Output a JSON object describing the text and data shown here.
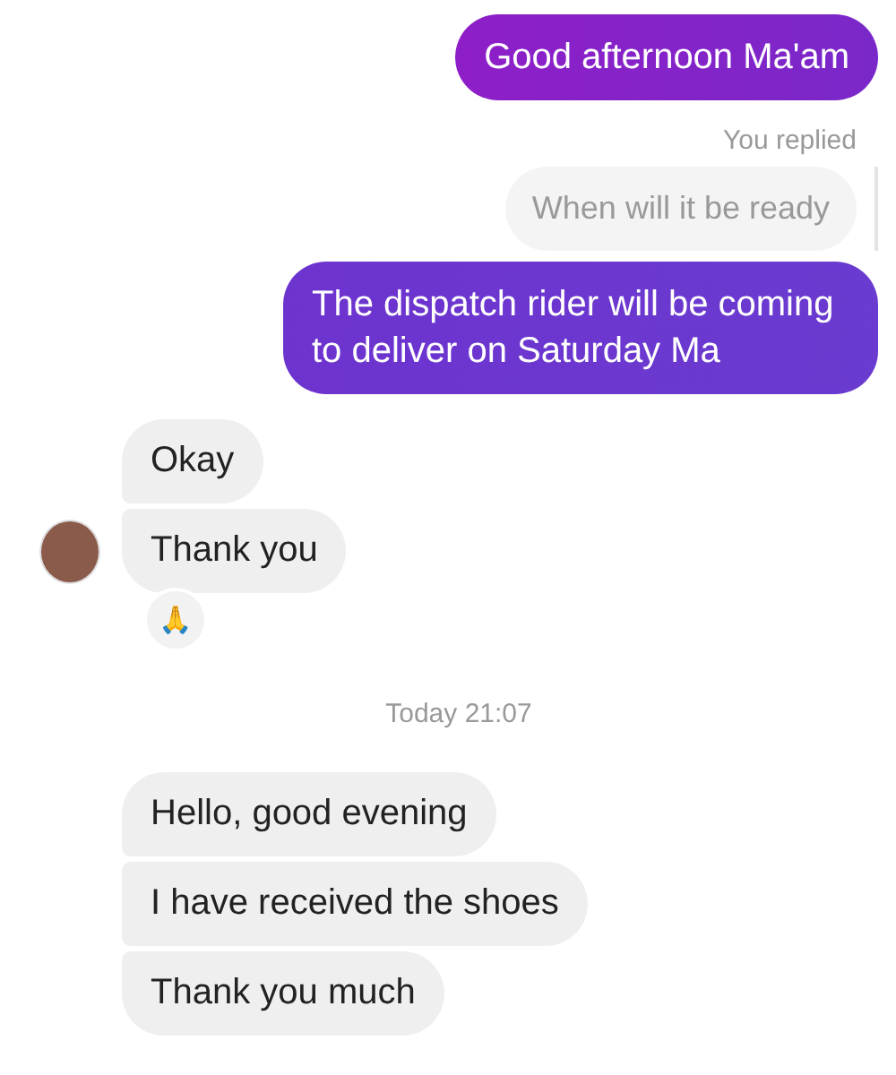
{
  "messages": [
    {
      "kind": "sent",
      "text": "Good afternoon Ma'am"
    },
    {
      "kind": "reply_note",
      "text": "You replied"
    },
    {
      "kind": "quoted",
      "text": "When will it be ready"
    },
    {
      "kind": "sent",
      "text": "The dispatch rider will be coming to deliver on Saturday Ma"
    },
    {
      "kind": "received",
      "text": "Okay",
      "avatar": false
    },
    {
      "kind": "received",
      "text": "Thank you",
      "avatar": true
    },
    {
      "kind": "reaction",
      "text": "🙏"
    },
    {
      "kind": "timestamp",
      "text": "Today 21:07"
    },
    {
      "kind": "received",
      "text": "Hello, good evening",
      "avatar": false
    },
    {
      "kind": "received",
      "text": "I have received the shoes",
      "avatar": false
    },
    {
      "kind": "received",
      "text": "Thank you much",
      "avatar": false
    }
  ]
}
